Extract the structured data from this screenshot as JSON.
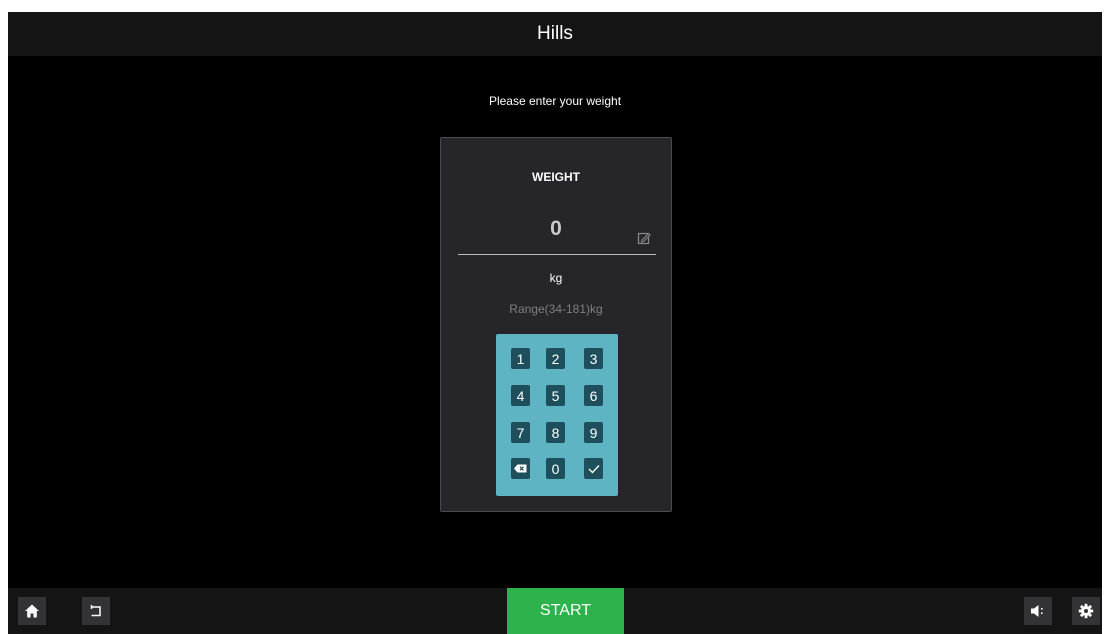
{
  "header": {
    "title": "Hills"
  },
  "prompt": "Please enter your weight",
  "weight_card": {
    "title": "WEIGHT",
    "value": "0",
    "unit": "kg",
    "range": "Range(34-181)kg"
  },
  "keypad": {
    "keys": [
      "1",
      "2",
      "3",
      "4",
      "5",
      "6",
      "7",
      "8",
      "9",
      "0"
    ],
    "backspace_icon": "backspace-icon",
    "confirm_icon": "check-icon"
  },
  "footer": {
    "start_label": "START",
    "home_icon": "home-icon",
    "back_icon": "back-icon",
    "volume_icon": "volume-icon",
    "settings_icon": "gear-icon"
  },
  "colors": {
    "background": "#000000",
    "bar": "#141414",
    "card": "#26262a",
    "keypad": "#5fb4c4",
    "key": "#1d4f5d",
    "start": "#2eb24c"
  }
}
